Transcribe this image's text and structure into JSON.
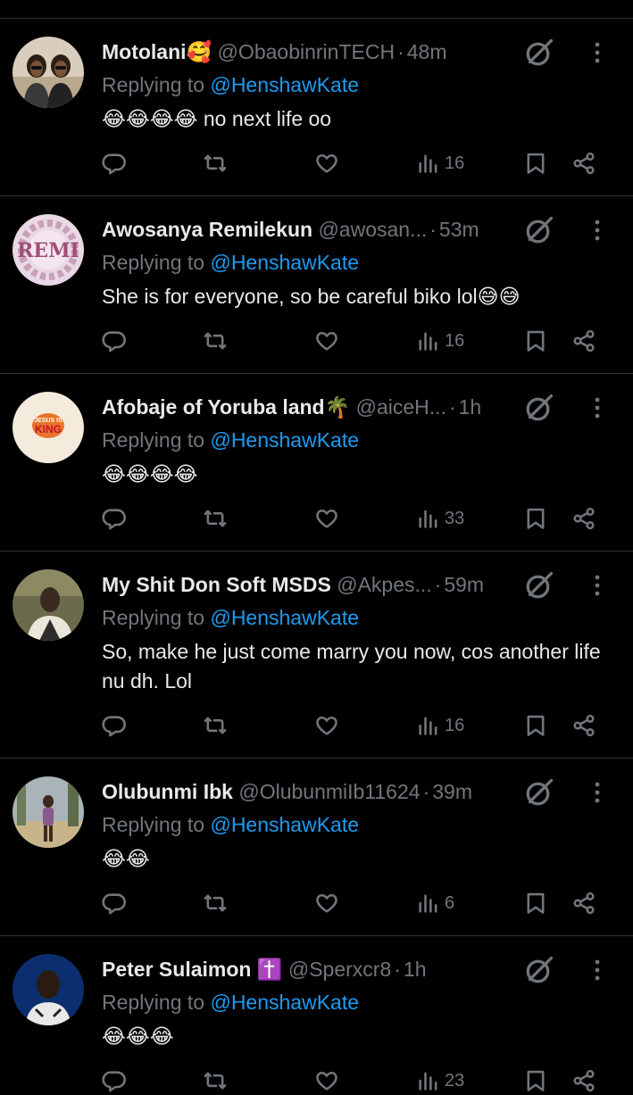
{
  "replies": [
    {
      "name": "Motolani🥰",
      "handle": "@ObaobinrinTECH",
      "time": "48m",
      "replying_prefix": "Replying to",
      "mention": "@HenshawKate",
      "text": "😂😂😂😂  no next life oo",
      "views": "16",
      "avatar": "two-women-photo"
    },
    {
      "name": "Awosanya Remilekun",
      "handle": "@awosan...",
      "time": "53m",
      "replying_prefix": "Replying to",
      "mention": "@HenshawKate",
      "text": "She is for everyone, so be careful biko lol😅😅",
      "views": "16",
      "avatar_text": "REMI"
    },
    {
      "name": "Afobaje of Yoruba land🌴",
      "handle": "@aiceH...",
      "time": "1h",
      "replying_prefix": "Replying to",
      "mention": "@HenshawKate",
      "text": "😂😂😂😂",
      "views": "33",
      "avatar_text_1": "JESUS IS",
      "avatar_text_2": "KING"
    },
    {
      "name": "My Shit Don Soft MSDS",
      "handle": "@Akpes...",
      "time": "59m",
      "replying_prefix": "Replying to",
      "mention": "@HenshawKate",
      "text": "So, make he just come marry you now, cos another life nu dh. Lol",
      "views": "16",
      "avatar": "man-photo"
    },
    {
      "name": "Olubunmi Ibk",
      "handle": "@OlubunmiIb11624",
      "time": "39m",
      "replying_prefix": "Replying to",
      "mention": "@HenshawKate",
      "text": "😂😂",
      "views": "6",
      "avatar": "woman-outdoor-photo"
    },
    {
      "name": "Peter Sulaimon ✝️",
      "handle": "@Sperxcr8",
      "time": "1h",
      "replying_prefix": "Replying to",
      "mention": "@HenshawKate",
      "text": "😂😂😂",
      "views": "23",
      "avatar": "man-portrait-blue"
    }
  ],
  "colors": {
    "background": "#000000",
    "text": "#e7e9ea",
    "muted": "#71767b",
    "link": "#1d9bf0",
    "divider": "#2f3336"
  }
}
